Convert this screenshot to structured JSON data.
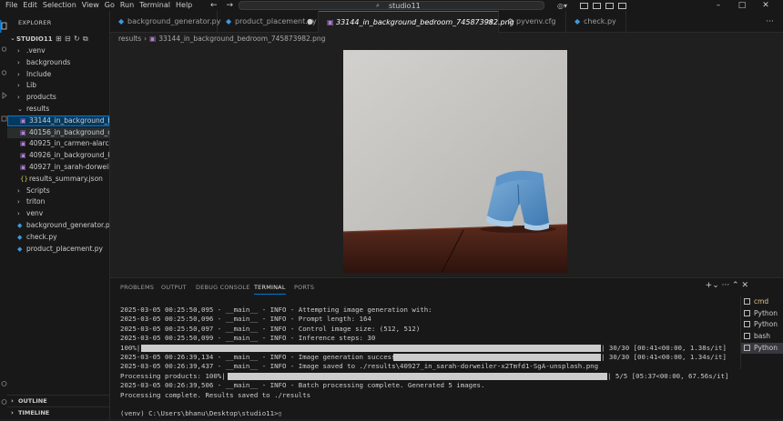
{
  "menu": [
    "File",
    "Edit",
    "Selection",
    "View",
    "Go",
    "Run",
    "Terminal",
    "Help"
  ],
  "nav": {
    "back_icon": "arrow-left-icon",
    "forward_icon": "arrow-right-icon"
  },
  "search": {
    "label": "studio11"
  },
  "explorer": {
    "title": "EXPLORER",
    "root": "STUDIO11",
    "items": [
      {
        "label": ".venv",
        "kind": "folder",
        "depth": 0,
        "expanded": false
      },
      {
        "label": "backgrounds",
        "kind": "folder",
        "depth": 0,
        "expanded": false
      },
      {
        "label": "Include",
        "kind": "folder",
        "depth": 0,
        "expanded": false
      },
      {
        "label": "Lib",
        "kind": "folder",
        "depth": 0,
        "expanded": false
      },
      {
        "label": "products",
        "kind": "folder",
        "depth": 0,
        "expanded": false
      },
      {
        "label": "results",
        "kind": "folder",
        "depth": 0,
        "expanded": true
      },
      {
        "label": "33144_in_background_b...",
        "kind": "image",
        "depth": 1,
        "state": "active"
      },
      {
        "label": "40156_in_background_o...",
        "kind": "image",
        "depth": 1,
        "state": "hover"
      },
      {
        "label": "40925_in_carmen-alarc...",
        "kind": "image",
        "depth": 1
      },
      {
        "label": "40926_in_background_k...",
        "kind": "image",
        "depth": 1
      },
      {
        "label": "40927_in_sarah-dorweil...",
        "kind": "image",
        "depth": 1
      },
      {
        "label": "results_summary.json",
        "kind": "json",
        "depth": 1
      },
      {
        "label": "Scripts",
        "kind": "folder",
        "depth": 0,
        "expanded": false
      },
      {
        "label": "triton",
        "kind": "folder",
        "depth": 0,
        "expanded": false
      },
      {
        "label": "venv",
        "kind": "folder",
        "depth": 0,
        "expanded": false
      },
      {
        "label": "background_generator.py",
        "kind": "python",
        "depth": 0
      },
      {
        "label": "check.py",
        "kind": "python",
        "depth": 0
      },
      {
        "label": "product_placement.py",
        "kind": "python",
        "depth": 0
      }
    ],
    "outline": "OUTLINE",
    "timeline": "TIMELINE"
  },
  "tabs": [
    {
      "label": "background_generator.py",
      "kind": "python",
      "active": false
    },
    {
      "label": "product_placement.py",
      "kind": "python",
      "active": false,
      "dirty": true
    },
    {
      "label": "33144_in_background_bedroom_745873982.png",
      "kind": "image",
      "active": true
    },
    {
      "label": "pyvenv.cfg",
      "kind": "config",
      "active": false
    },
    {
      "label": "check.py",
      "kind": "python",
      "active": false
    }
  ],
  "breadcrumb": [
    "results",
    "33144_in_background_bedroom_745873982.png"
  ],
  "panel": {
    "tabs": [
      "PROBLEMS",
      "OUTPUT",
      "DEBUG CONSOLE",
      "TERMINAL",
      "PORTS"
    ],
    "active_tab": "TERMINAL",
    "terminal_lines": [
      {
        "text": "2025-03-05 00:25:50,095 - __main__ - INFO - Attempting image generation with:"
      },
      {
        "text": "2025-03-05 00:25:50,096 - __main__ - INFO - Prompt length: 164"
      },
      {
        "text": "2025-03-05 00:25:50,097 - __main__ - INFO - Control image size: (512, 512)"
      },
      {
        "text": "2025-03-05 00:25:50,099 - __main__ - INFO - Inference steps: 30"
      },
      {
        "prefix": "100%|",
        "progress": 1.0,
        "suffix": "| 30/30 [00:41<00:00,  1.38s/it]"
      },
      {
        "text": "2025-03-05 00:26:39,134 - __main__ - INFO - Image generation successful",
        "overlay_suffix": "| 30/30 [00:41<00:00,  1.34s/it]"
      },
      {
        "text": "2025-03-05 00:26:39,437 - __main__ - INFO - Image saved to ./results\\40927_in_sarah-dorweiler-x2Tmfd1-SgA-unsplash.png"
      },
      {
        "prefix": "Processing products: 100%|",
        "progress": 1.0,
        "suffix": "| 5/5 [05:37<00:00, 67.56s/it]"
      },
      {
        "text": "2025-03-05 00:26:39,506 - __main__ - INFO - Batch processing complete. Generated 5 images."
      },
      {
        "text": "Processing complete. Results saved to ./results"
      },
      {
        "text": ""
      },
      {
        "text": "(venv) C:\\Users\\bhanu\\Desktop\\studio11>"
      }
    ],
    "terminals": [
      {
        "label": "cmd",
        "active": false
      },
      {
        "label": "Python",
        "active": false
      },
      {
        "label": "Python",
        "active": false
      },
      {
        "label": "bash",
        "active": false
      },
      {
        "label": "Python",
        "active": true
      }
    ]
  },
  "colors": {
    "accent": "#0078d4",
    "python": "#3c9be0",
    "image": "#b180d7",
    "json": "#cbcb41"
  }
}
